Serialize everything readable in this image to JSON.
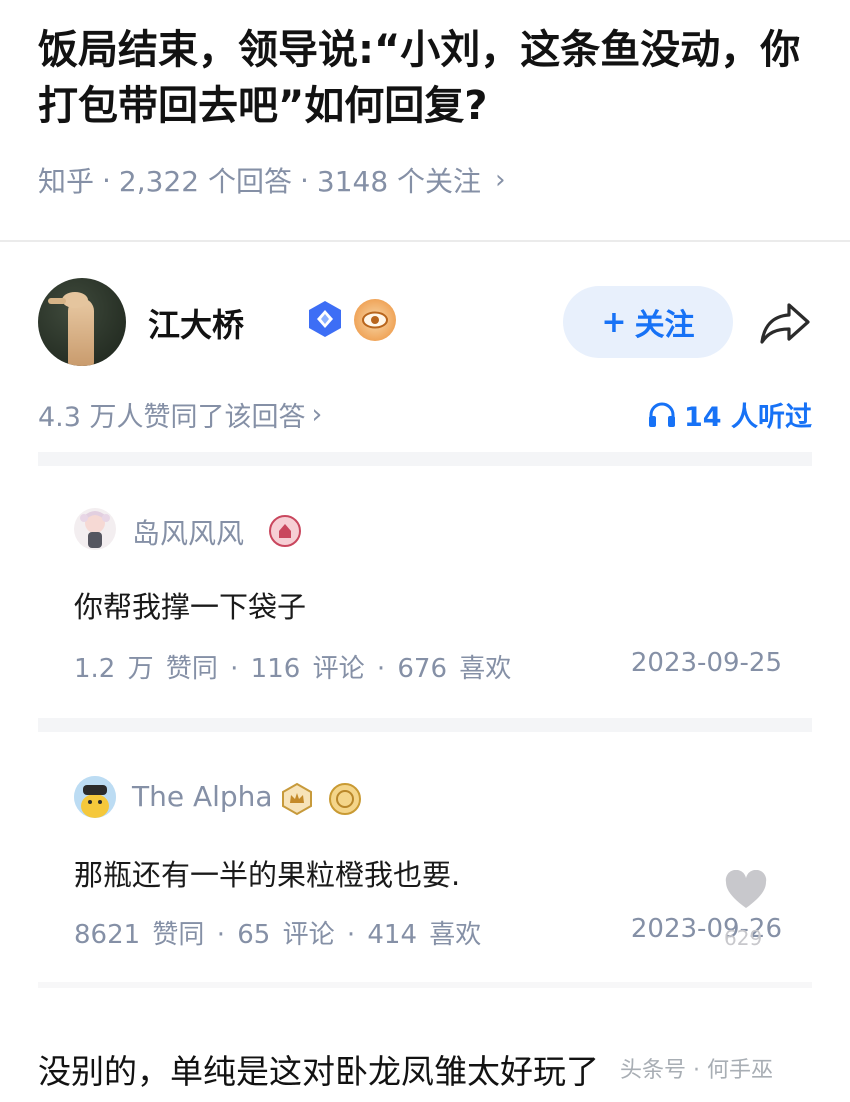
{
  "question": {
    "title": "饭局结束，领导说:“小刘，这条鱼没动，你打包带回去吧”如何回复?",
    "source": "知乎",
    "answers": "2,322 个回答",
    "follows": "3148 个关注",
    "sep": "·",
    "chevron": "›"
  },
  "author": {
    "name": "江大桥",
    "follow_label": "关注",
    "follow_plus": "+",
    "upvote_text": "4.3 万人赞同了该回答",
    "upvote_chevron": "›",
    "listened_text": "14 人听过"
  },
  "comments": [
    {
      "name": "岛风风风",
      "text": "你帮我撑一下袋子",
      "stats": "1.2 万 赞同 · 116 评论 · 676 喜欢",
      "date": "2023-09-25"
    },
    {
      "name": "The Alpha",
      "text": "那瓶还有一半的果粒橙我也要.",
      "stats": "8621 赞同 · 65 评论 · 414 喜欢",
      "date": "2023-09-26",
      "overlay_count": "629"
    }
  ],
  "bottom_text": "没别的，单纯是这对卧龙凤雏太好玩了",
  "watermark": "头条号 · 何手巫",
  "colors": {
    "accent": "#1772f6",
    "follow_bg": "#e8f0fc",
    "meta_gray": "#8590a6"
  },
  "icons": [
    "share-icon",
    "headphone-icon",
    "verified-badge-icon",
    "eye-badge-icon",
    "heart-icon"
  ]
}
